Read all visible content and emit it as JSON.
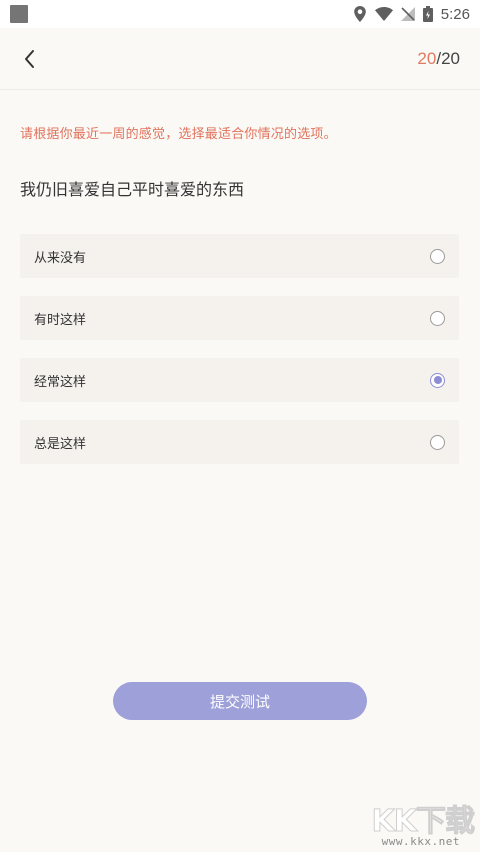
{
  "status_bar": {
    "time": "5:26",
    "icons": [
      "notification-square-icon",
      "location-icon",
      "wifi-icon",
      "no-signal-icon",
      "battery-icon"
    ]
  },
  "header": {
    "back_icon": "chevron-left-icon",
    "progress_current": "20",
    "progress_separator": "/",
    "progress_total": "20"
  },
  "instruction": "请根据你最近一周的感觉，选择最适合你情况的选项。",
  "question": "我仍旧喜爱自己平时喜爱的东西",
  "options": [
    {
      "label": "从来没有",
      "selected": false
    },
    {
      "label": "有时这样",
      "selected": false
    },
    {
      "label": "经常这样",
      "selected": true
    },
    {
      "label": "总是这样",
      "selected": false
    }
  ],
  "submit_label": "提交测试",
  "watermark": {
    "main": "KK下载",
    "sub": "www.kkx.net"
  },
  "colors": {
    "accent_orange": "#e07a5f",
    "accent_purple": "#9ea0d9",
    "background": "#fbf9f6",
    "option_bg": "#f5f2ee"
  }
}
